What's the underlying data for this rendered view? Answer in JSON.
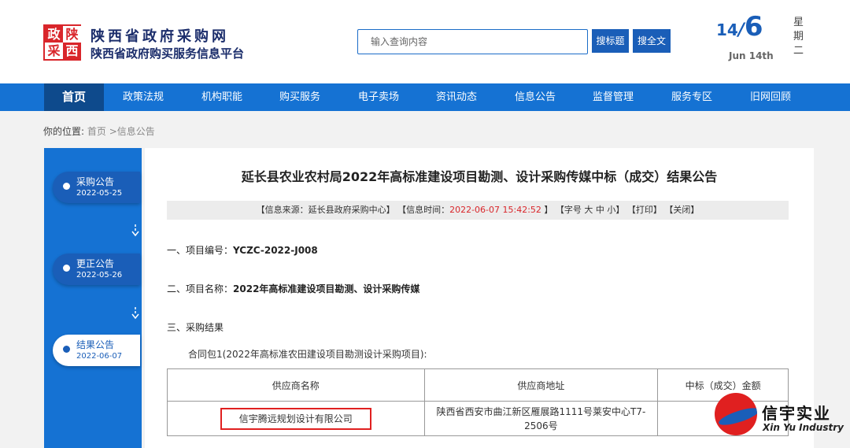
{
  "header": {
    "logo_chars": [
      "政",
      "陕",
      "采",
      "西"
    ],
    "site_title": "陕西省政府采购网",
    "site_subtitle": "陕西省政府购买服务信息平台",
    "search": {
      "placeholder": "输入查询内容",
      "btn_title": "搜标题",
      "btn_full": "搜全文"
    },
    "date": {
      "month": "14",
      "slash": "/",
      "day": "6",
      "sub": "Jun 14th",
      "weekday": "星期二"
    }
  },
  "nav": {
    "items": [
      "首页",
      "政策法规",
      "机构职能",
      "购买服务",
      "电子卖场",
      "资讯动态",
      "信息公告",
      "监督管理",
      "服务专区",
      "旧网回顾"
    ],
    "active_index": 0
  },
  "breadcrumb": {
    "label": "你的位置:",
    "path": "首页 >信息公告"
  },
  "sidebar": {
    "items": [
      {
        "label": "采购公告",
        "date": "2022-05-25"
      },
      {
        "label": "更正公告",
        "date": "2022-05-26"
      },
      {
        "label": "结果公告",
        "date": "2022-06-07"
      }
    ],
    "active_index": 2
  },
  "article": {
    "title": "延长县农业农村局2022年高标准建设项目勘测、设计采购传媒中标（成交）结果公告",
    "meta": {
      "source": "【信息来源：延长县政府采购中心】",
      "time_label": "【信息时间：",
      "time_value": "2022-06-07 15:42:52",
      "time_close": "】",
      "font_size": "【字号 大 中 小】",
      "print": "【打印】",
      "close": "【关闭】"
    },
    "section1_label": "一、项目编号：",
    "section1_value": "YCZC-2022-J008",
    "section2_label": "二、项目名称：",
    "section2_value": "2022年高标准建设项目勘测、设计采购传媒",
    "section3_label": "三、采购结果",
    "package": "合同包1(2022年高标准农田建设项目勘测设计采购项目):",
    "table": {
      "headers": [
        "供应商名称",
        "供应商地址",
        "中标（成交）金额"
      ],
      "rows": [
        {
          "name": "信宇腾远规划设计有限公司",
          "address": "陕西省西安市曲江新区雁展路1111号莱安中心T7-2506号",
          "amount": ""
        }
      ]
    }
  },
  "watermark": {
    "cn": "信宇实业",
    "en": "Xin Yu Industry"
  },
  "colors": {
    "primary_blue": "#1572d3",
    "dark_blue": "#1a5eb8",
    "nav_active": "#0e4a8c",
    "accent_red": "#d9262b"
  }
}
